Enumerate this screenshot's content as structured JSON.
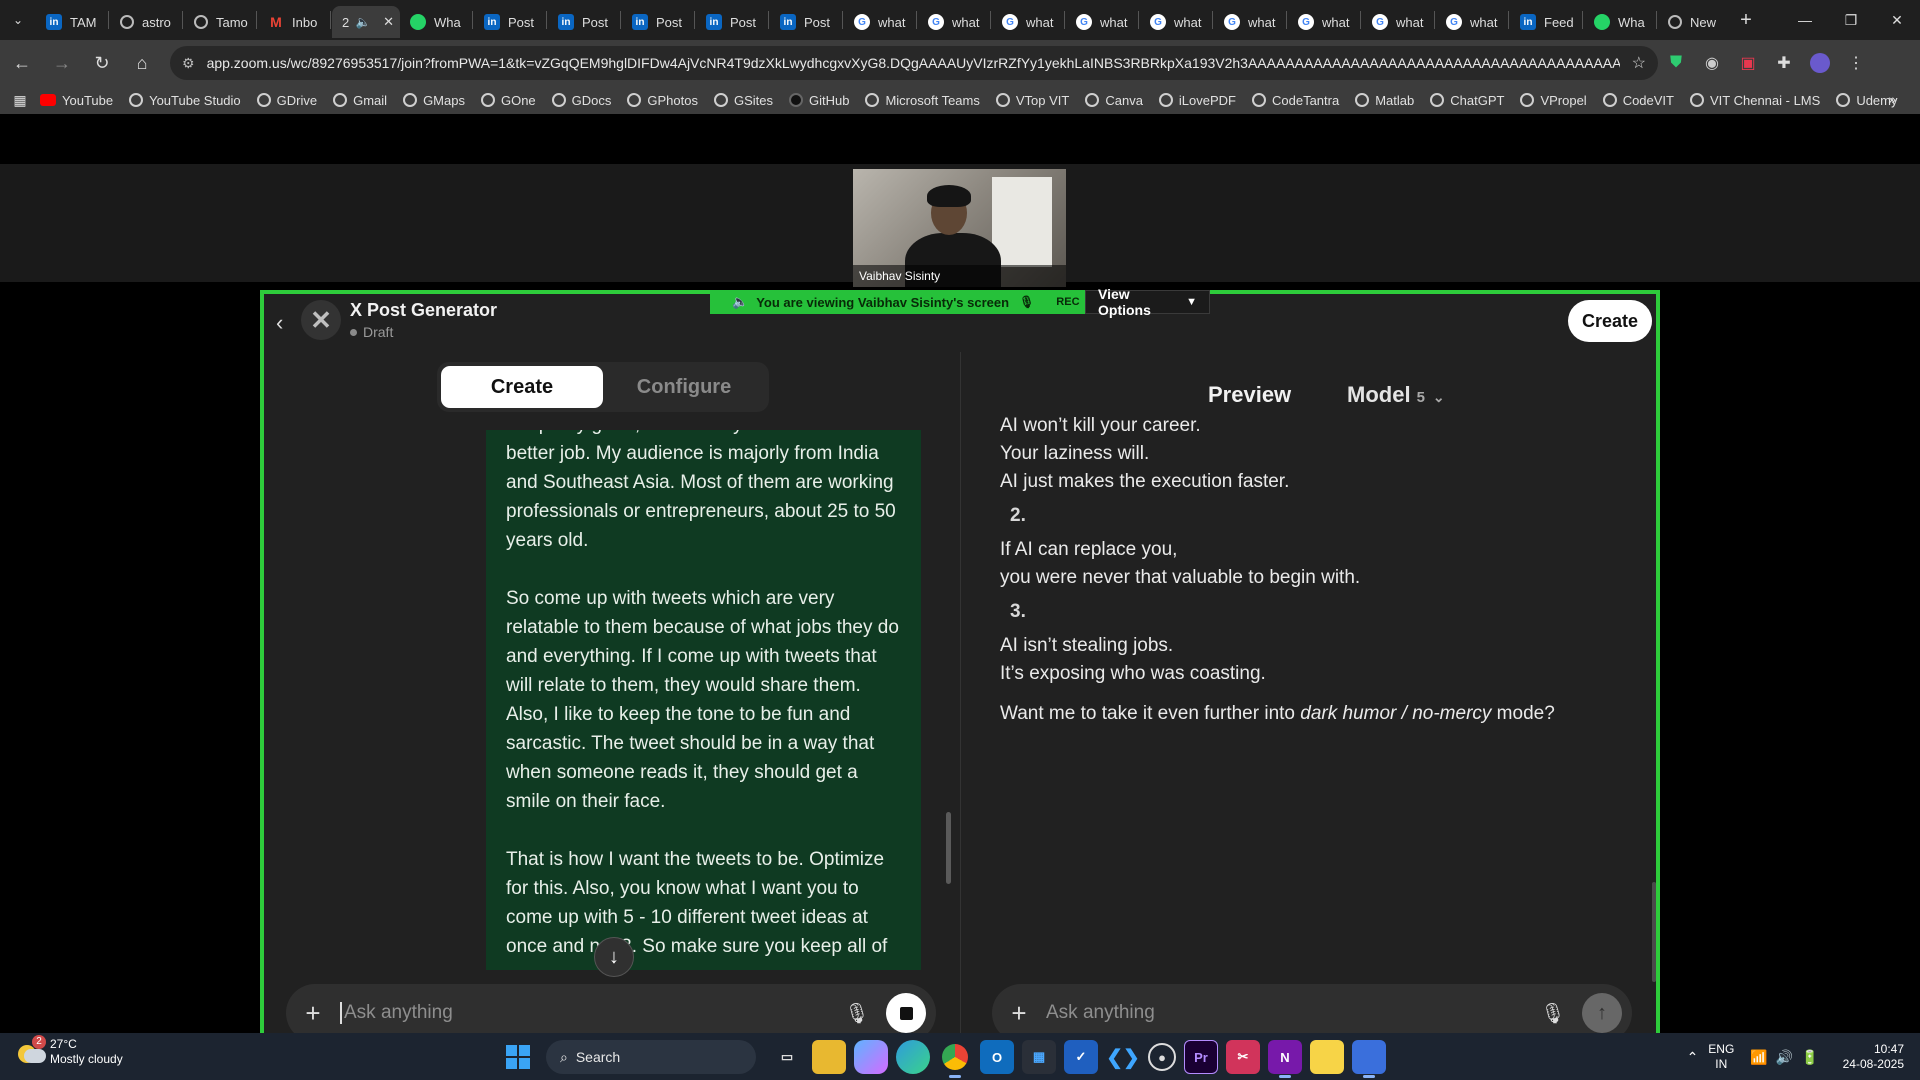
{
  "browser": {
    "tabs": [
      {
        "label": "TAM",
        "icon": "linkedin-icon"
      },
      {
        "label": "astro",
        "icon": "generic-icon"
      },
      {
        "label": "Tamo",
        "icon": "generic-icon"
      },
      {
        "label": "Inbo",
        "icon": "gmail-icon"
      },
      {
        "label": "2",
        "icon": "speaker-icon",
        "active": true
      },
      {
        "label": "Wha",
        "icon": "whatsapp-icon"
      },
      {
        "label": "Post",
        "icon": "linkedin-icon"
      },
      {
        "label": "Post",
        "icon": "linkedin-icon"
      },
      {
        "label": "Post",
        "icon": "linkedin-icon"
      },
      {
        "label": "Post",
        "icon": "linkedin-icon"
      },
      {
        "label": "Post",
        "icon": "linkedin-icon"
      },
      {
        "label": "what",
        "icon": "google-icon"
      },
      {
        "label": "what",
        "icon": "google-icon"
      },
      {
        "label": "what",
        "icon": "google-icon"
      },
      {
        "label": "what",
        "icon": "google-icon"
      },
      {
        "label": "what",
        "icon": "google-icon"
      },
      {
        "label": "what",
        "icon": "google-icon"
      },
      {
        "label": "what",
        "icon": "google-icon"
      },
      {
        "label": "what",
        "icon": "google-icon"
      },
      {
        "label": "what",
        "icon": "google-icon"
      },
      {
        "label": "Feed",
        "icon": "linkedin-icon"
      },
      {
        "label": "Wha",
        "icon": "whatsapp-icon"
      },
      {
        "label": "New",
        "icon": "generic-icon"
      }
    ],
    "url": "app.zoom.us/wc/89276953517/join?fromPWA=1&tk=vZGqQEM9hglDIFDw4AjVcNR4T9dzXkLwydhcgxvXyG8.DQgAAAAUyVIzrRZfYy1yekhLaINBS3RBRkpXa193V2h3AAAAAAAAAAAAAAAAAAAAAAAAAAAAAAAAAAAAAAAA&_x_zm_r...",
    "bookmarks": [
      "YouTube",
      "YouTube Studio",
      "GDrive",
      "Gmail",
      "GMaps",
      "GOne",
      "GDocs",
      "GPhotos",
      "GSites",
      "GitHub",
      "Microsoft Teams",
      "VTop VIT",
      "Canva",
      "iLovePDF",
      "CodeTantra",
      "Matlab",
      "ChatGPT",
      "VPropel",
      "CodeVIT",
      "VIT Chennai - LMS",
      "Udemy"
    ]
  },
  "zoom": {
    "participant_name": "Vaibhav Sisinty",
    "banner_viewing": "You are viewing",
    "banner_screen": "Vaibhav Sisinty's screen",
    "banner_rec": "REC",
    "view_options": "View Options",
    "accent_color": "#26c13a"
  },
  "gpt": {
    "name": "X Post Generator",
    "status": "Draft",
    "create_button": "Create",
    "tabs": {
      "create": "Create",
      "configure": "Configure"
    },
    "user_message": [
      "are pretty great, but I want you to do a much better job. My audience is majorly from India and Southeast Asia. Most of them are working professionals or entrepreneurs, about 25 to 50 years old.",
      "So come up with tweets which are very relatable to them because of what jobs they do and everything. If I come up with tweets that will relate to them, they would share them. Also, I like to keep the tone to be fun and sarcastic. The tweet should be in a way that when someone reads it, they should get a smile on their face.",
      "That is how I want the tweets to be. Optimize for this. Also, you know what I want you to come up with 5 - 10 different tweet ideas at once and not 3. So make sure you keep all of"
    ],
    "composer_placeholder": "Ask anything",
    "preview": {
      "title": "Preview",
      "model_label": "Model",
      "model_version": "5",
      "lines": [
        {
          "kind": "text",
          "text": "AI won’t kill your career."
        },
        {
          "kind": "text",
          "text": "Your laziness will."
        },
        {
          "kind": "text",
          "text": "AI just makes the execution faster."
        },
        {
          "kind": "num",
          "text": "2."
        },
        {
          "kind": "text",
          "text": "If AI can replace you,"
        },
        {
          "kind": "text",
          "text": "you were never that valuable to begin with."
        },
        {
          "kind": "num",
          "text": "3."
        },
        {
          "kind": "text",
          "text": "AI isn’t stealing jobs."
        },
        {
          "kind": "text",
          "text": "It’s exposing who was coasting."
        }
      ],
      "closing_prefix": "Want me to take it even further into ",
      "closing_italic": "dark humor / no-mercy",
      "closing_suffix": " mode?"
    }
  },
  "taskbar": {
    "weather_temp": "27°C",
    "weather_desc": "Mostly cloudy",
    "weather_badge": "2",
    "search_label": "Search",
    "lang_top": "ENG",
    "lang_bottom": "IN",
    "time": "10:47",
    "date": "24-08-2025"
  }
}
